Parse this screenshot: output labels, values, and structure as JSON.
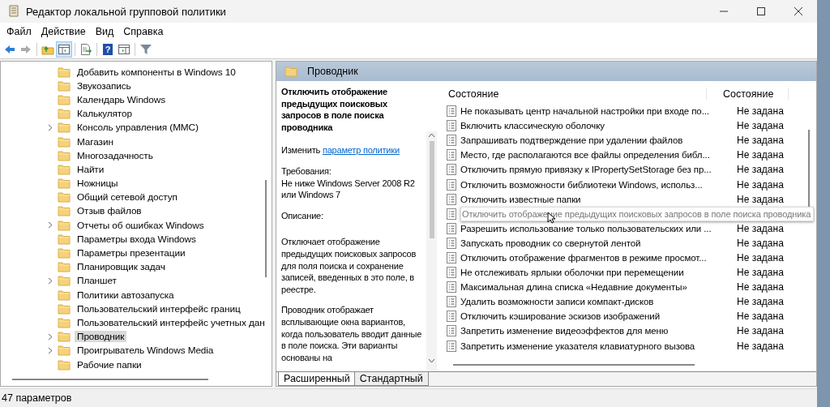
{
  "window": {
    "title": "Редактор локальной групповой политики"
  },
  "menu": [
    "Файл",
    "Действие",
    "Вид",
    "Справка"
  ],
  "toolbar": [
    {
      "kind": "back",
      "disabled": false,
      "pressed": false
    },
    {
      "kind": "forward",
      "disabled": true,
      "pressed": false
    },
    {
      "kind": "up",
      "disabled": false,
      "pressed": false
    },
    {
      "kind": "tree",
      "disabled": false,
      "pressed": true
    },
    {
      "kind": "export",
      "disabled": false,
      "pressed": false
    },
    {
      "kind": "help",
      "disabled": false,
      "pressed": false,
      "glyph": "?"
    },
    {
      "kind": "pane",
      "disabled": false,
      "pressed": false
    },
    {
      "kind": "filter",
      "disabled": false,
      "pressed": false
    }
  ],
  "tree": {
    "items": [
      {
        "label": "Добавить компоненты в Windows 10",
        "expandable": false,
        "selected": false
      },
      {
        "label": "Звукозапись",
        "expandable": false,
        "selected": false
      },
      {
        "label": "Календарь Windows",
        "expandable": false,
        "selected": false
      },
      {
        "label": "Калькулятор",
        "expandable": false,
        "selected": false
      },
      {
        "label": "Консоль управления (MMC)",
        "expandable": true,
        "selected": false
      },
      {
        "label": "Магазин",
        "expandable": false,
        "selected": false
      },
      {
        "label": "Многозадачность",
        "expandable": false,
        "selected": false
      },
      {
        "label": "Найти",
        "expandable": false,
        "selected": false
      },
      {
        "label": "Ножницы",
        "expandable": false,
        "selected": false
      },
      {
        "label": "Общий сетевой доступ",
        "expandable": false,
        "selected": false
      },
      {
        "label": "Отзыв файлов",
        "expandable": false,
        "selected": false
      },
      {
        "label": "Отчеты об ошибках Windows",
        "expandable": true,
        "selected": false
      },
      {
        "label": "Параметры входа Windows",
        "expandable": false,
        "selected": false
      },
      {
        "label": "Параметры презентации",
        "expandable": false,
        "selected": false
      },
      {
        "label": "Планировщик задач",
        "expandable": false,
        "selected": false
      },
      {
        "label": "Планшет",
        "expandable": true,
        "selected": false
      },
      {
        "label": "Политики автозапуска",
        "expandable": false,
        "selected": false
      },
      {
        "label": "Пользовательский интерфейс границ",
        "expandable": false,
        "selected": false
      },
      {
        "label": "Пользовательский интерфейс учетных дан",
        "expandable": false,
        "selected": false
      },
      {
        "label": "Проводник",
        "expandable": true,
        "selected": true
      },
      {
        "label": "Проигрыватель Windows Media",
        "expandable": true,
        "selected": false
      },
      {
        "label": "Рабочие папки",
        "expandable": false,
        "selected": false
      }
    ]
  },
  "details": {
    "header": "Проводник",
    "policy_title": "Отключить отображение предыдущих поисковых запросов в поле поиска проводника",
    "edit_prefix": "Изменить",
    "edit_link": "параметр политики",
    "requirements_label": "Требования:",
    "requirements": "Не ниже Windows Server 2008 R2 или Windows 7",
    "description_label": "Описание:",
    "paragraphs": [
      "Отключает отображение предыдущих поисковых запросов для поля поиска и сохранение записей, введенных в это поле, в реестре.",
      "Проводник отображает всплывающие окна вариантов, когда пользователь вводит данные в поле поиска.  Эти варианты основаны на"
    ]
  },
  "table": {
    "columns": [
      "Состояние",
      "Состояние"
    ],
    "rows": [
      {
        "kind": "setting",
        "name": "Не показывать центр начальной настройки при входе по...",
        "state": "Не задана"
      },
      {
        "kind": "setting",
        "name": "Включить классическую оболочку",
        "state": "Не задана"
      },
      {
        "kind": "setting",
        "name": "Запрашивать подтверждение при удалении файлов",
        "state": "Не задана"
      },
      {
        "kind": "setting",
        "name": "Место, где располагаются все файлы определения библ...",
        "state": "Не задана"
      },
      {
        "kind": "setting",
        "name": "Отключить прямую привязку к IPropertySetStorage без пр...",
        "state": "Не задана"
      },
      {
        "kind": "setting",
        "name": "Отключить возможности библиотеки Windows, использ...",
        "state": "Не задана"
      },
      {
        "kind": "setting",
        "name": "Отключить известные папки",
        "state": "Не задана"
      },
      {
        "kind": "tooltip",
        "name": "Отключить отображение предыдущих поисковых запросов в поле поиска проводника"
      },
      {
        "kind": "setting",
        "name": "Разрешить использование только пользовательских или ...",
        "state": "Не задана"
      },
      {
        "kind": "setting",
        "name": "Запускать проводник со свернутой лентой",
        "state": "Не задана"
      },
      {
        "kind": "setting",
        "name": "Отключить отображение фрагментов в режиме просмот...",
        "state": "Не задана"
      },
      {
        "kind": "setting",
        "name": "Не отслеживать ярлыки оболочки при перемещении",
        "state": "Не задана"
      },
      {
        "kind": "setting",
        "name": "Максимальная длина списка «Недавние документы»",
        "state": "Не задана"
      },
      {
        "kind": "setting",
        "name": "Удалить возможности записи компакт-дисков",
        "state": "Не задана"
      },
      {
        "kind": "setting",
        "name": "Отключить кэширование эскизов изображений",
        "state": "Не задана"
      },
      {
        "kind": "setting",
        "name": "Запретить изменение видеоэффектов для меню",
        "state": "Не задана"
      },
      {
        "kind": "setting",
        "name": "Запретить изменение указателя клавиатурного вызова",
        "state": "Не задана"
      }
    ]
  },
  "view_tabs": [
    {
      "label": "Расширенный",
      "selected": true
    },
    {
      "label": "Стандартный",
      "selected": false
    }
  ],
  "status_bar": "47 параметров"
}
